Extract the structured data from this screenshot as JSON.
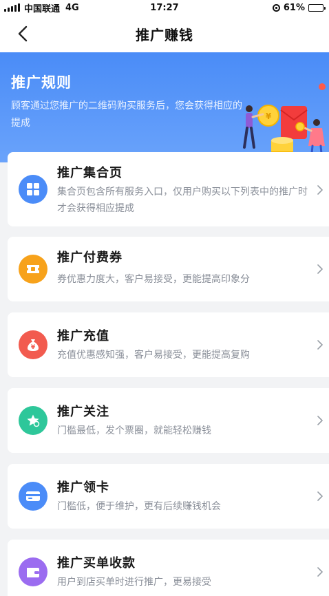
{
  "status_bar": {
    "carrier": "中国联通",
    "network": "4G",
    "time": "17:27",
    "battery": "61%",
    "battery_level": 0.61
  },
  "nav": {
    "title": "推广赚钱",
    "back_icon": "chevron-left-icon"
  },
  "banner": {
    "title": "推广规则",
    "description": "顾客通过您推广的二维码购买服务后，您会获得相应的提成"
  },
  "items": [
    {
      "title": "推广集合页",
      "description": "集合页包含所有服务入口，仅用户购买以下列表中的推广时才会获得相应提成",
      "icon": "grid-icon",
      "color": "#4b8cf8"
    },
    {
      "title": "推广付费券",
      "description": "券优惠力度大，客户易接受，更能提高印象分",
      "icon": "ticket-icon",
      "color": "#f7a21b"
    },
    {
      "title": "推广充值",
      "description": "充值优惠感知强，客户易接受，更能提高复购",
      "icon": "money-bag-icon",
      "color": "#f25b4f"
    },
    {
      "title": "推广关注",
      "description": "门槛最低，发个票圈，就能轻松赚钱",
      "icon": "star-icon",
      "color": "#2ec79a"
    },
    {
      "title": "推广领卡",
      "description": "门槛低，便于维护，更有后续赚钱机会",
      "icon": "card-icon",
      "color": "#4b8cf8"
    },
    {
      "title": "推广买单收款",
      "description": "用户到店买单时进行推广，更易接受",
      "icon": "wallet-icon",
      "color": "#9b6cf0"
    }
  ]
}
